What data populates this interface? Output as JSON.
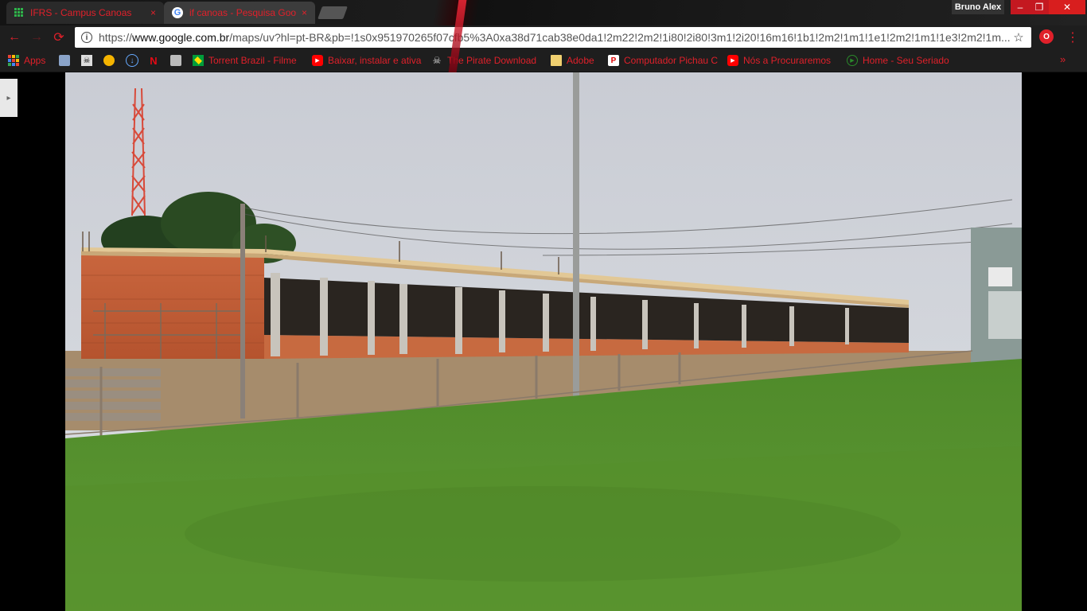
{
  "window": {
    "profile_name": "Bruno Alex",
    "minimize_label": "–",
    "maximize_label": "❐",
    "close_label": "✕"
  },
  "tabs": [
    {
      "title": "IFRS - Campus Canoas",
      "favicon": "ifrs-grid-icon",
      "close": "×"
    },
    {
      "title": "if canoas - Pesquisa Goo",
      "favicon": "google-icon",
      "close": "×"
    }
  ],
  "toolbar": {
    "back": "←",
    "forward": "→",
    "reload": "⟳",
    "url_scheme": "https://",
    "url_host": "www.google.com.br",
    "url_rest": "/maps/uv?hl=pt-BR&pb=!1s0x951970265f07cfb5%3A0xa38d71cab38e0da1!2m22!2m2!1i80!2i80!3m1!2i20!16m16!1b1!2m2!1m1!1e1!2m2!1m1!1e3!2m2!1m...",
    "info_icon": "i",
    "star_icon": "☆",
    "opera_icon": "O",
    "menu_icon": "⋮"
  },
  "bookmarks": {
    "apps_label": "Apps",
    "items": [
      {
        "label": "Torrent Brazil - Filme",
        "icon": "brazil-flag-icon"
      },
      {
        "label": "Baixar, instalar e ativa",
        "icon": "youtube-icon"
      },
      {
        "label": "The Pirate Download",
        "icon": "pirate-ship-icon"
      },
      {
        "label": "Adobe",
        "icon": "folder-icon"
      },
      {
        "label": "Computador Pichau C",
        "icon": "pichau-icon"
      },
      {
        "label": "Nós a Procuraremos",
        "icon": "youtube-icon"
      },
      {
        "label": "Home - Seu Seriado",
        "icon": "play-icon"
      }
    ],
    "overflow": "»"
  },
  "content": {
    "side_toggle": "▸"
  }
}
